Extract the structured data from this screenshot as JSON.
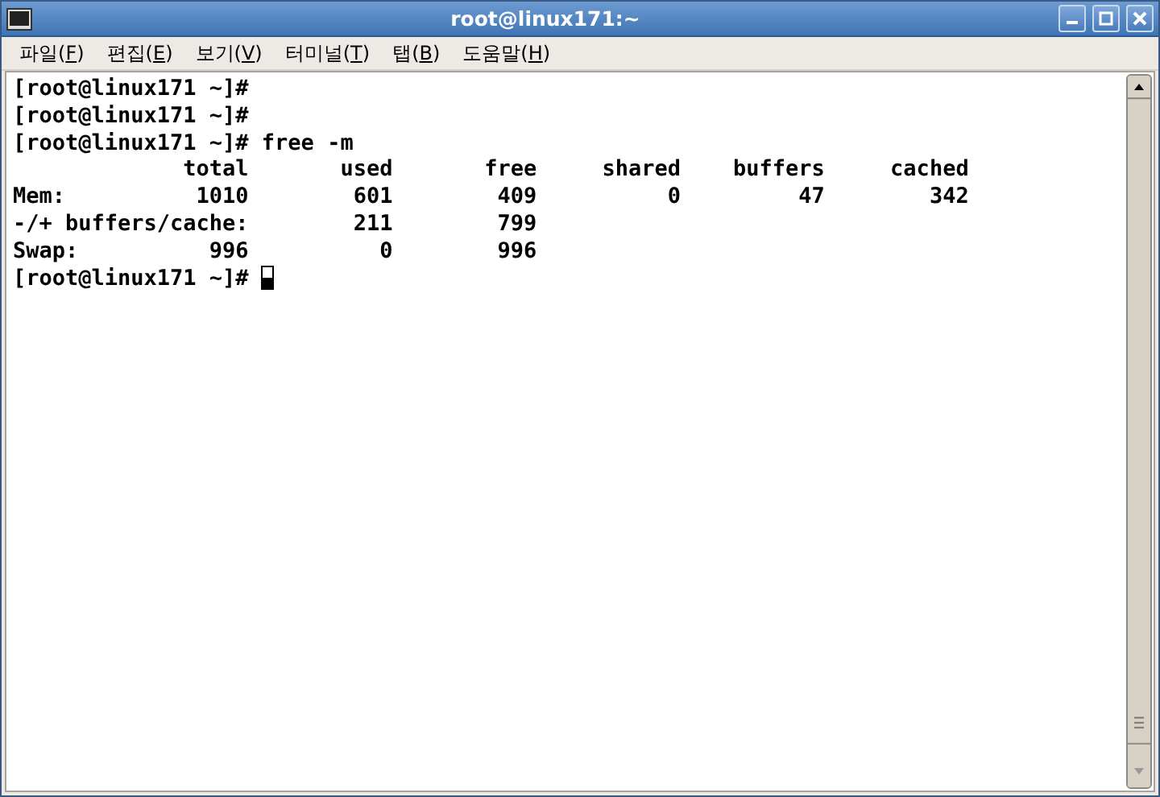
{
  "window": {
    "title": "root@linux171:~"
  },
  "menu": [
    {
      "before": "파일(",
      "key": "F",
      "after": ")"
    },
    {
      "before": "편집(",
      "key": "E",
      "after": ")"
    },
    {
      "before": "보기(",
      "key": "V",
      "after": ")"
    },
    {
      "before": "터미널(",
      "key": "T",
      "after": ")"
    },
    {
      "before": "탭(",
      "key": "B",
      "after": ")"
    },
    {
      "before": "도움말(",
      "key": "H",
      "after": ")"
    }
  ],
  "terminal": {
    "lines": [
      "[root@linux171 ~]#",
      "[root@linux171 ~]#",
      "[root@linux171 ~]# free -m",
      "             total       used       free     shared    buffers     cached",
      "Mem:          1010        601        409          0         47        342",
      "-/+ buffers/cache:        211        799",
      "Swap:          996          0        996",
      "[root@linux171 ~]# "
    ],
    "cursor": true
  }
}
